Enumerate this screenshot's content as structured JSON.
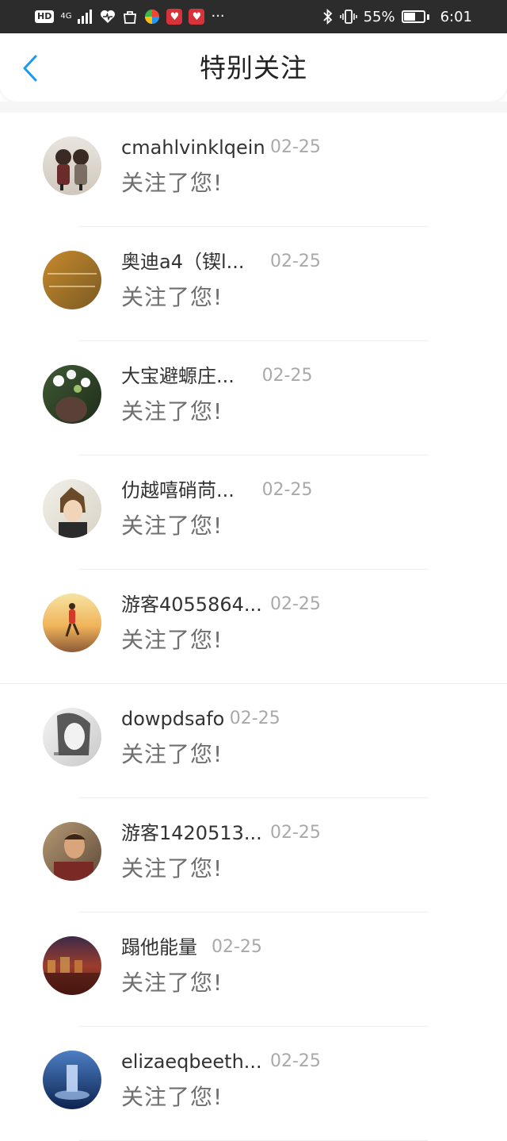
{
  "status_bar": {
    "hd": "HD",
    "network": "4G",
    "battery_percent": "55%",
    "battery_level": 0.55,
    "time": "6:01",
    "more": "···"
  },
  "nav": {
    "title": "特别关注",
    "back_icon": "chevron-left-icon",
    "accent_color": "#1a9bf0"
  },
  "items": [
    {
      "name": "cmahlvinklqein",
      "date": "02-25",
      "message": "关注了您!",
      "avatar": "dolls-avatar"
    },
    {
      "name": "奥迪a4（锲l...",
      "date": "02-25",
      "message": "关注了您!",
      "avatar": "text-avatar"
    },
    {
      "name": "大宝避螈庄...",
      "date": "02-25",
      "message": "关注了您!",
      "avatar": "flowers-avatar"
    },
    {
      "name": "仂越嘻硝苘...",
      "date": "02-25",
      "message": "关注了您!",
      "avatar": "anime-avatar"
    },
    {
      "name": "游客4055864...",
      "date": "02-25",
      "message": "关注了您!",
      "avatar": "runner-avatar"
    },
    {
      "name": "dowpdsafo",
      "date": "02-25",
      "message": "关注了您!",
      "avatar": "sketch-avatar"
    },
    {
      "name": "游客1420513...",
      "date": "02-25",
      "message": "关注了您!",
      "avatar": "man-avatar"
    },
    {
      "name": "蹋他能量",
      "date": "02-25",
      "message": "关注了您!",
      "avatar": "city-avatar"
    },
    {
      "name": "elizaeqbeeth...",
      "date": "02-25",
      "message": "关注了您!",
      "avatar": "waterfall-avatar"
    }
  ]
}
